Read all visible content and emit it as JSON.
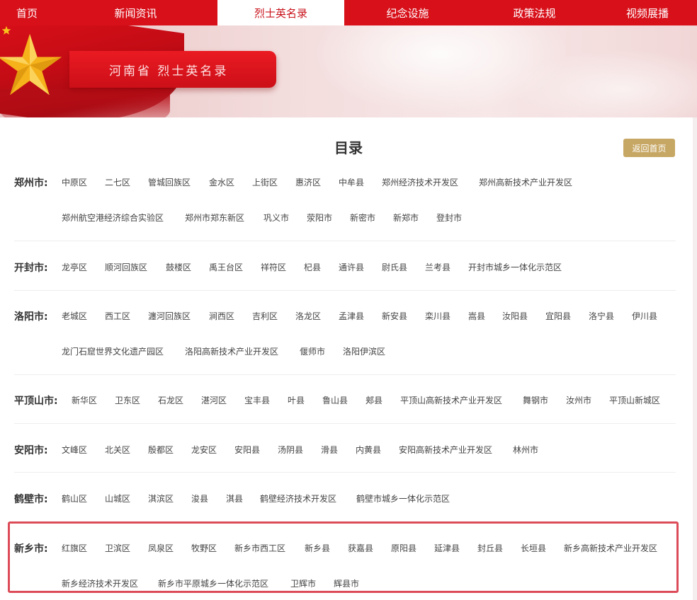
{
  "nav": {
    "items": [
      {
        "label": "首页",
        "active": false
      },
      {
        "label": "新闻资讯",
        "active": false
      },
      {
        "label": "烈士英名录",
        "active": true
      },
      {
        "label": "纪念设施",
        "active": false
      },
      {
        "label": "政策法规",
        "active": false
      },
      {
        "label": "视频展播",
        "active": false
      }
    ]
  },
  "banner": {
    "title": "河南省 烈士英名录"
  },
  "page": {
    "title": "目录",
    "back_label": "返回首页"
  },
  "colors": {
    "nav_red": "#d8101a",
    "active_text": "#c8121b",
    "gold_button": "#c7a764",
    "highlight_border": "#dc4b58"
  },
  "cities": [
    {
      "name": "郑州市:",
      "districts": [
        "中原区",
        "二七区",
        "管城回族区",
        "金水区",
        "上街区",
        "惠济区",
        "中牟县",
        "郑州经济技术开发区",
        "郑州高新技术产业开发区",
        "郑州航空港经济综合实验区",
        "郑州市郑东新区",
        "巩义市",
        "荥阳市",
        "新密市",
        "新郑市",
        "登封市"
      ]
    },
    {
      "name": "开封市:",
      "districts": [
        "龙亭区",
        "顺河回族区",
        "鼓楼区",
        "禹王台区",
        "祥符区",
        "杞县",
        "通许县",
        "尉氏县",
        "兰考县",
        "开封市城乡一体化示范区"
      ]
    },
    {
      "name": "洛阳市:",
      "districts": [
        "老城区",
        "西工区",
        "瀍河回族区",
        "涧西区",
        "吉利区",
        "洛龙区",
        "孟津县",
        "新安县",
        "栾川县",
        "嵩县",
        "汝阳县",
        "宜阳县",
        "洛宁县",
        "伊川县",
        "龙门石窟世界文化遗产园区",
        "洛阳高新技术产业开发区",
        "偃师市",
        "洛阳伊滨区"
      ]
    },
    {
      "name": "平顶山市:",
      "districts": [
        "新华区",
        "卫东区",
        "石龙区",
        "湛河区",
        "宝丰县",
        "叶县",
        "鲁山县",
        "郏县",
        "平顶山高新技术产业开发区",
        "舞钢市",
        "汝州市",
        "平顶山新城区"
      ]
    },
    {
      "name": "安阳市:",
      "districts": [
        "文峰区",
        "北关区",
        "殷都区",
        "龙安区",
        "安阳县",
        "汤阴县",
        "滑县",
        "内黄县",
        "安阳高新技术产业开发区",
        "林州市"
      ]
    },
    {
      "name": "鹤壁市:",
      "districts": [
        "鹤山区",
        "山城区",
        "淇滨区",
        "浚县",
        "淇县",
        "鹤壁经济技术开发区",
        "鹤壁市城乡一体化示范区"
      ]
    },
    {
      "name": "新乡市:",
      "districts": [
        "红旗区",
        "卫滨区",
        "凤泉区",
        "牧野区",
        "新乡市西工区",
        "新乡县",
        "获嘉县",
        "原阳县",
        "延津县",
        "封丘县",
        "长垣县",
        "新乡高新技术产业开发区",
        "新乡经济技术开发区",
        "新乡市平原城乡一体化示范区",
        "卫辉市",
        "辉县市"
      ]
    }
  ]
}
